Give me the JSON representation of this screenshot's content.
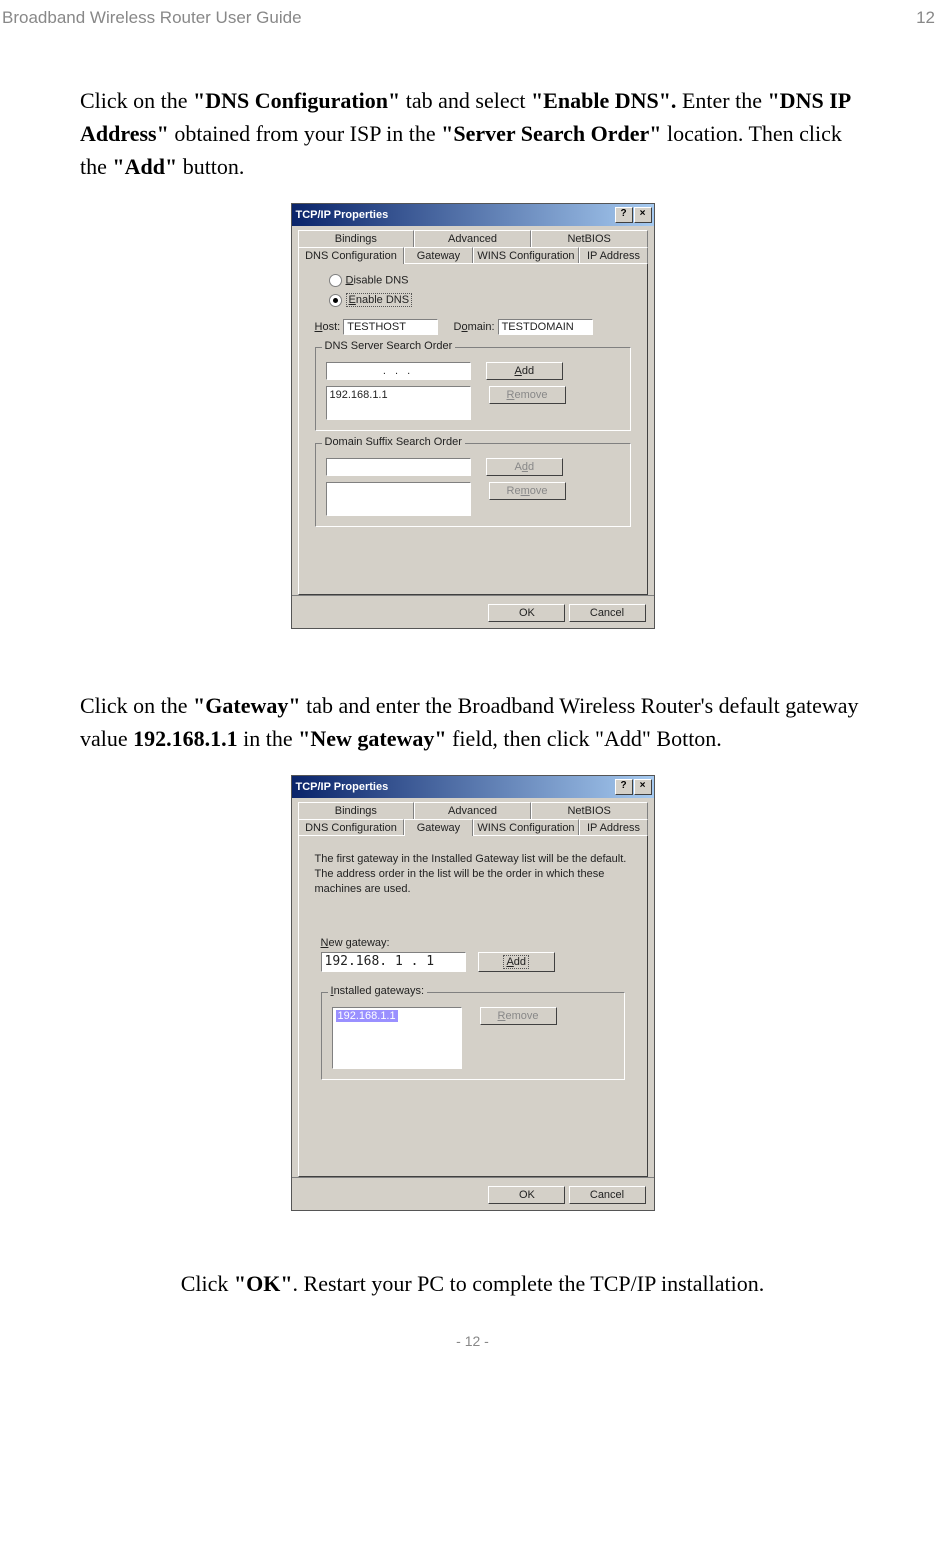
{
  "header": {
    "title": "Broadband Wireless Router User Guide",
    "page": "12"
  },
  "para1": {
    "t1": "Click on the ",
    "b1": "\"DNS Configuration\"",
    "t2": " tab and select ",
    "b2": "\"Enable DNS\".",
    "t3": " Enter the ",
    "b3": "\"DNS IP Address\"",
    "t4": " obtained from your ISP in the ",
    "b4": "\"Server Search Order\"",
    "t5": " location. Then click the ",
    "b5": "\"Add\"",
    "t6": " button."
  },
  "dialog1": {
    "title": "TCP/IP Properties",
    "tabs_top": [
      "Bindings",
      "Advanced",
      "NetBIOS"
    ],
    "tabs_bottom": [
      "DNS Configuration",
      "Gateway",
      "WINS Configuration",
      "IP Address"
    ],
    "active_tab": "DNS Configuration",
    "disable_dns": "Disable DNS",
    "enable_dns": "Enable DNS",
    "host_label": "Host:",
    "host_value": "TESTHOST",
    "domain_label": "Domain:",
    "domain_value": "TESTDOMAIN",
    "search_order_label": "DNS Server Search Order",
    "ip_input": ".    .    .",
    "dns_list_item": "192.168.1.1",
    "suffix_label": "Domain Suffix Search Order",
    "add": "Add",
    "remove": "Remove",
    "ok": "OK",
    "cancel": "Cancel"
  },
  "para2": {
    "t1": "Click on the ",
    "b1": "\"Gateway\"",
    "t2": " tab and enter the Broadband Wireless Router's default gateway value ",
    "b2": "192.168.1.1",
    "t3": " in the ",
    "b3": "\"New gateway\"",
    "t4": " field, then click \"Add\" Botton."
  },
  "dialog2": {
    "title": "TCP/IP Properties",
    "tabs_top": [
      "Bindings",
      "Advanced",
      "NetBIOS"
    ],
    "tabs_bottom": [
      "DNS Configuration",
      "Gateway",
      "WINS Configuration",
      "IP Address"
    ],
    "active_tab": "Gateway",
    "explan": "The first gateway in the Installed Gateway list will be the default. The address order in the list will be the order in which these machines are used.",
    "new_gw_label": "New gateway:",
    "new_gw_value": "192.168. 1 . 1",
    "installed_label": "Installed gateways:",
    "installed_item": "192.168.1.1",
    "add": "Add",
    "remove": "Remove",
    "ok": "OK",
    "cancel": "Cancel"
  },
  "para3": {
    "t1": "Click ",
    "b1": "\"OK\"",
    "t2": ". Restart your PC to complete the TCP/IP installation."
  },
  "footer": "- 12 -"
}
